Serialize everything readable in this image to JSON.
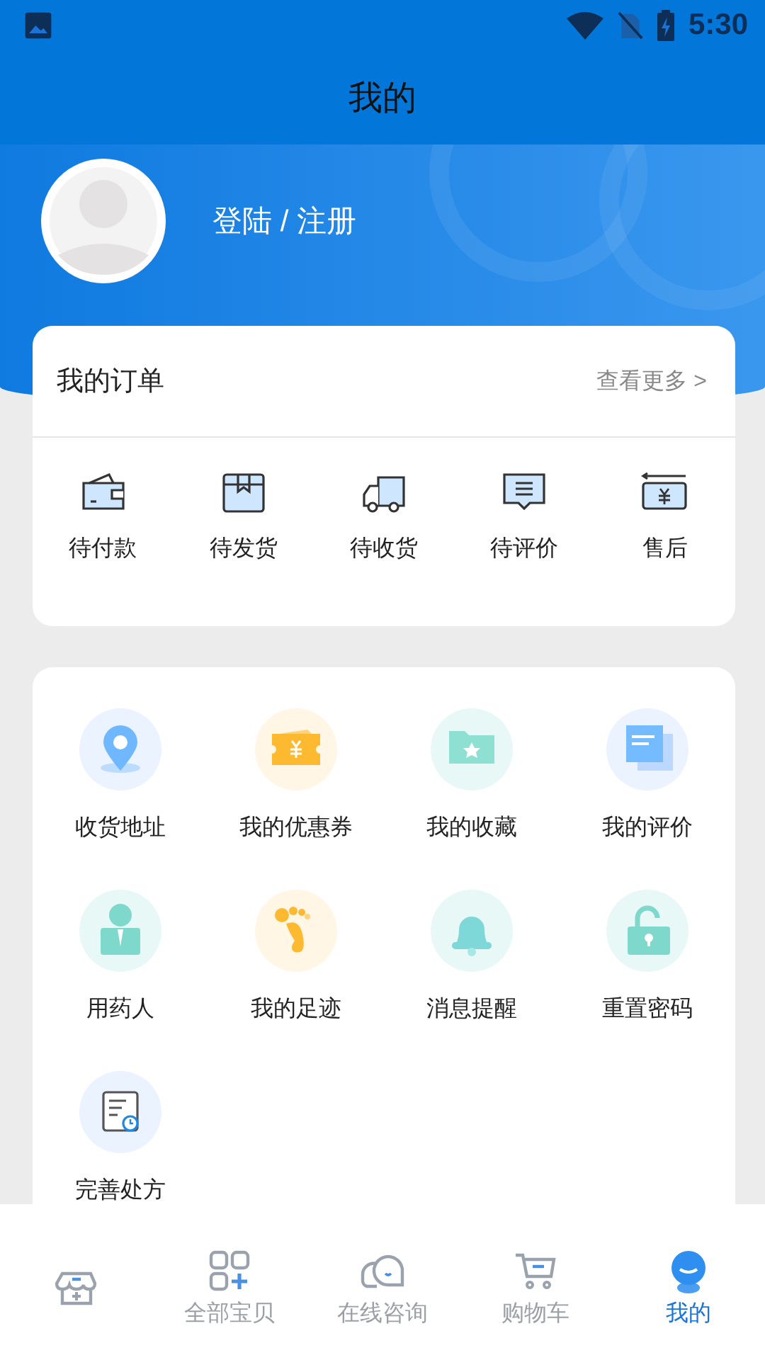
{
  "status_bar": {
    "time": "5:30"
  },
  "title": "我的",
  "profile": {
    "login_text": "登陆 / 注册"
  },
  "orders": {
    "title": "我的订单",
    "more": "查看更多 >",
    "items": [
      {
        "label": "待付款"
      },
      {
        "label": "待发货"
      },
      {
        "label": "待收货"
      },
      {
        "label": "待评价"
      },
      {
        "label": "售后"
      }
    ]
  },
  "services": [
    {
      "label": "收货地址"
    },
    {
      "label": "我的优惠券"
    },
    {
      "label": "我的收藏"
    },
    {
      "label": "我的评价"
    },
    {
      "label": "用药人"
    },
    {
      "label": "我的足迹"
    },
    {
      "label": "消息提醒"
    },
    {
      "label": "重置密码"
    },
    {
      "label": "完善处方"
    }
  ],
  "tabs": [
    {
      "selected": false
    },
    {
      "label": "全部宝贝",
      "selected": false
    },
    {
      "label": "在线咨询",
      "selected": false
    },
    {
      "label": "购物车",
      "selected": false
    },
    {
      "label": "我的",
      "selected": true
    }
  ]
}
